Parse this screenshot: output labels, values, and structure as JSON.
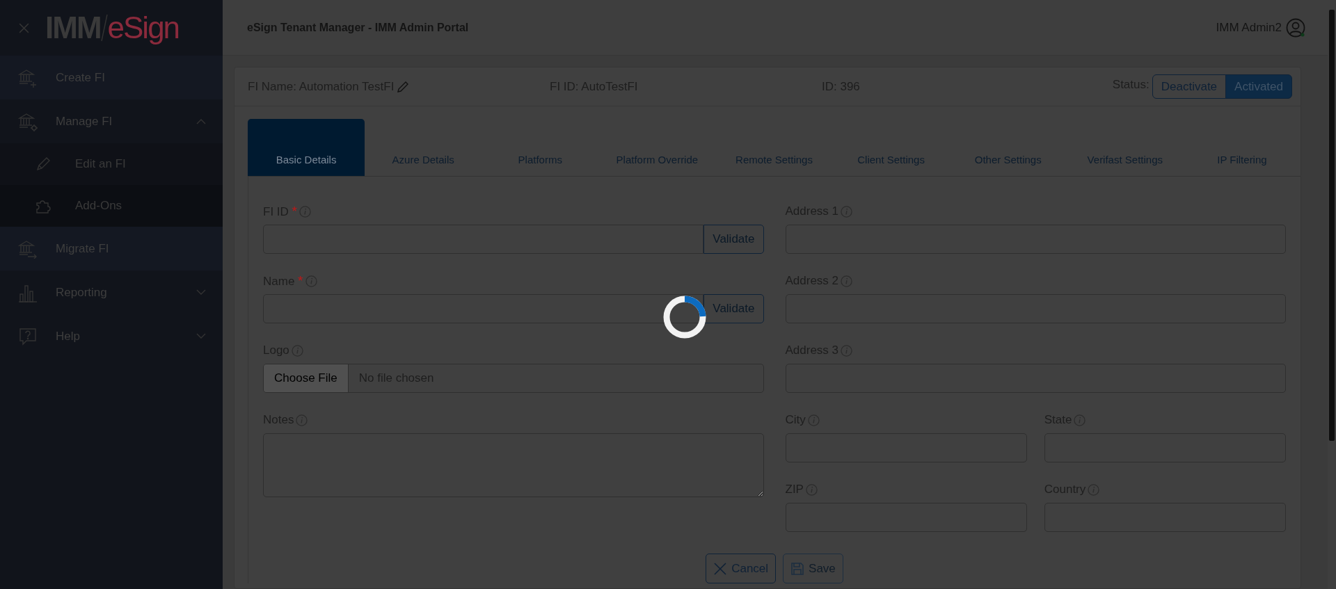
{
  "logo": {
    "left": "IMM",
    "right": "eSign"
  },
  "sidebar": {
    "items": [
      {
        "label": "Create FI",
        "kind": "link"
      },
      {
        "label": "Manage FI",
        "kind": "group",
        "expanded": true,
        "children": [
          {
            "label": "Edit an FI",
            "selected": true
          },
          {
            "label": "Add-Ons",
            "selected": false
          }
        ]
      },
      {
        "label": "Migrate FI",
        "kind": "link"
      },
      {
        "label": "Reporting",
        "kind": "group",
        "expanded": false
      },
      {
        "label": "Help",
        "kind": "group",
        "expanded": false
      }
    ]
  },
  "header": {
    "title": "eSign Tenant Manager - IMM Admin Portal",
    "user": "IMM Admin2"
  },
  "fi_bar": {
    "name": "FI Name: Automation TestFI",
    "fi_id": "FI ID: AutoTestFI",
    "id": "ID: 396",
    "status_label": "Status:",
    "status_options": [
      {
        "label": "Deactivate",
        "selected": false
      },
      {
        "label": "Activated",
        "selected": true
      }
    ]
  },
  "tabs": [
    {
      "label": "Basic Details",
      "selected": true
    },
    {
      "label": "Azure Details",
      "selected": false
    },
    {
      "label": "Platforms",
      "selected": false
    },
    {
      "label": "Platform Override",
      "selected": false
    },
    {
      "label": "Remote Settings",
      "selected": false
    },
    {
      "label": "Client Settings",
      "selected": false
    },
    {
      "label": "Other Settings",
      "selected": false
    },
    {
      "label": "Verifast Settings",
      "selected": false
    },
    {
      "label": "IP Filtering",
      "selected": false
    }
  ],
  "left_fields": [
    {
      "label": "FI ID",
      "required": true,
      "kind": "validate",
      "button": "Validate"
    },
    {
      "label": "Name",
      "required": true,
      "kind": "validate",
      "button": "Validate"
    },
    {
      "label": "Logo",
      "required": false,
      "kind": "file",
      "button": "Choose File",
      "file_text": "No file chosen"
    },
    {
      "label": "Notes",
      "required": false,
      "kind": "textarea"
    }
  ],
  "right_rows": [
    [
      {
        "label": "Address 1",
        "required": false
      }
    ],
    [
      {
        "label": "Address 2",
        "required": false
      }
    ],
    [
      {
        "label": "Address 3",
        "required": false
      }
    ],
    [
      {
        "label": "City",
        "required": false
      },
      {
        "label": "State",
        "required": false
      }
    ],
    [
      {
        "label": "ZIP",
        "required": false
      },
      {
        "label": "Country",
        "required": false
      }
    ]
  ],
  "required_mark": "*",
  "actions": [
    {
      "label": "Cancel",
      "kind": "cancel",
      "disabled": false
    },
    {
      "label": "Save",
      "kind": "save",
      "disabled": true
    }
  ]
}
